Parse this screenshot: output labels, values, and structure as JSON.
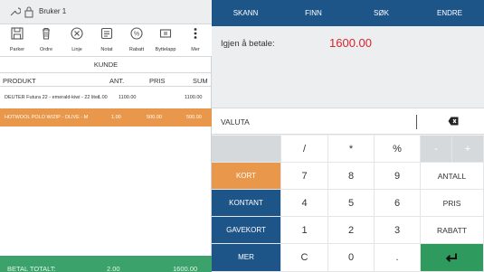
{
  "topbar": {
    "user": "Bruker 1"
  },
  "toolbar": {
    "items": [
      {
        "label": "Parker",
        "icon": "save-icon"
      },
      {
        "label": "Ordre",
        "icon": "trash-icon"
      },
      {
        "label": "Linje",
        "icon": "close-circle-icon"
      },
      {
        "label": "Notat",
        "icon": "note-icon"
      },
      {
        "label": "Rabatt",
        "icon": "percent-icon"
      },
      {
        "label": "Byttelapp",
        "icon": "receipt-icon"
      },
      {
        "label": "Mer",
        "icon": "more-vertical-icon"
      }
    ]
  },
  "customer": {
    "label": "KUNDE"
  },
  "table": {
    "headers": {
      "produkt": "PRODUKT",
      "ant": "ANT.",
      "pris": "PRIS",
      "sum": "SUM"
    },
    "rows": [
      {
        "produkt": "DEUTER Futura 22 - emerald-kiwi - 22 liter",
        "ant": "1.00",
        "pris": "1100.00",
        "sum": "1100.00"
      },
      {
        "produkt": "HOTWOOL POLO W/ZIP - OLIVE - M",
        "ant": "1.00",
        "pris": "500.00",
        "sum": "500.00"
      }
    ]
  },
  "total": {
    "label": "BETAL TOTALT:",
    "qty": "2.00",
    "amount": "1600.00"
  },
  "tabs": [
    "SKANN",
    "FINN",
    "SØK",
    "ENDRE"
  ],
  "payment": {
    "label": "Igjen å betale:",
    "amount": "1600.00"
  },
  "valuta": {
    "label": "VALUTA"
  },
  "keypad": {
    "row1": [
      "",
      "/",
      "*",
      "%",
      "-",
      "+"
    ],
    "row2": [
      "KORT",
      "7",
      "8",
      "9",
      "ANTALL"
    ],
    "row3": [
      "KONTANT",
      "4",
      "5",
      "6",
      "PRIS"
    ],
    "row4": [
      "GAVEKORT",
      "1",
      "2",
      "3",
      "RABATT"
    ],
    "row5": [
      "MER",
      "C",
      "0",
      "."
    ]
  },
  "colors": {
    "primary": "#1e5589",
    "accent": "#e9974b",
    "total": "#3aa26a",
    "enter": "#2f9a5e",
    "amount": "#d9232e"
  }
}
